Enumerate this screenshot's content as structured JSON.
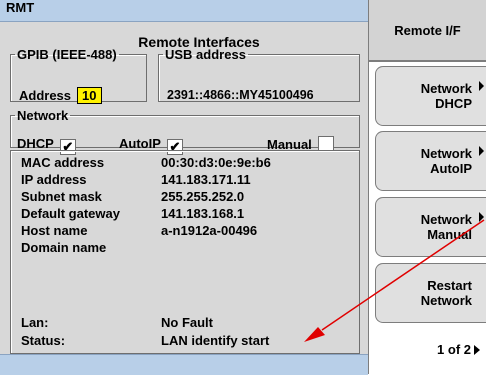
{
  "status_bar": {
    "label": "RMT"
  },
  "panel": {
    "title": "Remote Interfaces",
    "gpib": {
      "legend": "GPIB (IEEE-488)",
      "address_label": "Address",
      "address_value": "10"
    },
    "usb": {
      "legend": "USB address",
      "value": "2391::4866::MY45100496"
    },
    "network": {
      "legend": "Network",
      "dhcp": {
        "label": "DHCP",
        "checked": true,
        "mark": "✔"
      },
      "autoip": {
        "label": "AutoIP",
        "checked": true,
        "mark": "✔"
      },
      "manual": {
        "label": "Manual",
        "checked": false,
        "mark": ""
      }
    },
    "info": [
      {
        "key": "MAC address",
        "value": "00:30:d3:0e:9e:b6"
      },
      {
        "key": "IP address",
        "value": "141.183.171.11"
      },
      {
        "key": "Subnet mask",
        "value": "255.255.252.0"
      },
      {
        "key": "Default gateway",
        "value": "141.183.168.1"
      },
      {
        "key": "Host name",
        "value": "a-n1912a-00496"
      },
      {
        "key": "Domain name",
        "value": ""
      }
    ],
    "lan": {
      "key": "Lan:",
      "value": "No Fault"
    },
    "status": {
      "key": "Status:",
      "value": "LAN identify start"
    }
  },
  "softkeys": {
    "title": "Remote I/F",
    "keys": [
      {
        "line1": "Network",
        "line2": "DHCP"
      },
      {
        "line1": "Network",
        "line2": "AutoIP"
      },
      {
        "line1": "Network",
        "line2": "Manual"
      },
      {
        "line1": "Restart",
        "line2": "Network"
      }
    ],
    "page_indicator": "1 of 2"
  },
  "colors": {
    "status_bar": "#b8cfe8",
    "address_highlight": "#fff200",
    "annotation_arrow": "#e00000"
  }
}
